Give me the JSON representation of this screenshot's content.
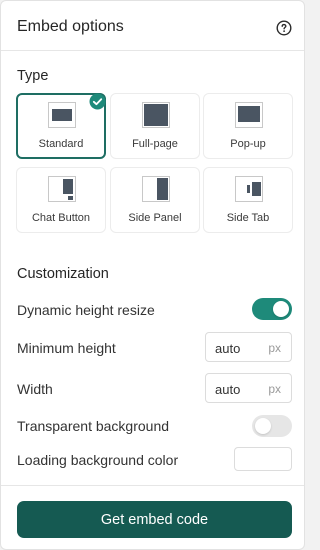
{
  "header": {
    "title": "Embed options",
    "help_icon": "question-circle-icon"
  },
  "type_section": {
    "heading": "Type",
    "selected": "Standard",
    "options": [
      {
        "label": "Standard",
        "icon": "standard-embed-icon"
      },
      {
        "label": "Full-page",
        "icon": "full-page-embed-icon"
      },
      {
        "label": "Pop-up",
        "icon": "pop-up-embed-icon"
      },
      {
        "label": "Chat Button",
        "icon": "chat-button-embed-icon"
      },
      {
        "label": "Side Panel",
        "icon": "side-panel-embed-icon"
      },
      {
        "label": "Side Tab",
        "icon": "side-tab-embed-icon"
      }
    ]
  },
  "customization": {
    "heading": "Customization",
    "dynamic_height": {
      "label": "Dynamic height resize",
      "enabled": true
    },
    "min_height": {
      "label": "Minimum height",
      "value": "auto",
      "unit": "px"
    },
    "width": {
      "label": "Width",
      "value": "auto",
      "unit": "px"
    },
    "transparent_bg": {
      "label": "Transparent background",
      "enabled": false
    },
    "loading_bg": {
      "label": "Loading background color",
      "color": "#ffffff"
    }
  },
  "footer": {
    "cta_label": "Get embed code"
  },
  "colors": {
    "accent": "#1e8a7a",
    "accent_dark": "#155a52",
    "icon_fill": "#4a5562"
  }
}
